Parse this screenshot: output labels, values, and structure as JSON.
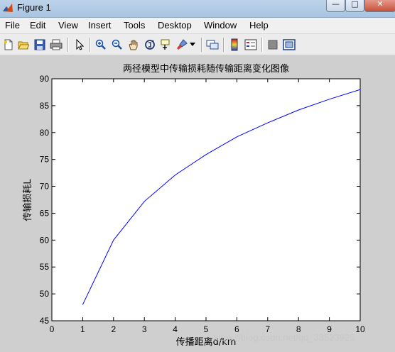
{
  "window": {
    "title": "Figure 1",
    "min_glyph": "—",
    "max_glyph": "□",
    "close_glyph": "✕"
  },
  "menu": [
    "File",
    "Edit",
    "View",
    "Insert",
    "Tools",
    "Desktop",
    "Window",
    "Help"
  ],
  "toolbar_icons": [
    "new-figure-icon",
    "open-file-icon",
    "save-icon",
    "print-icon",
    "edit-plot-arrow-icon",
    "zoom-in-icon",
    "zoom-out-icon",
    "pan-hand-icon",
    "rotate-3d-icon",
    "data-cursor-icon",
    "brush-icon",
    "brush-dropdown-icon",
    "link-plot-icon",
    "colorbar-icon",
    "legend-icon",
    "hide-plot-tools-icon",
    "show-plot-tools-icon"
  ],
  "chart_data": {
    "type": "line",
    "title": "两径模型中传输损耗随传输距离变化图像",
    "xlabel": "传播距离d/km",
    "ylabel": "传输损耗L",
    "xlim": [
      0,
      10
    ],
    "ylim": [
      45,
      90
    ],
    "xticks": [
      0,
      1,
      2,
      3,
      4,
      5,
      6,
      7,
      8,
      9,
      10
    ],
    "yticks": [
      45,
      50,
      55,
      60,
      65,
      70,
      75,
      80,
      85,
      90
    ],
    "grid": false,
    "line_color": "#0000ff",
    "series": [
      {
        "x": [
          1,
          2,
          3,
          4,
          5,
          6,
          7,
          8,
          9,
          10
        ],
        "y": [
          48.0,
          60.0,
          67.2,
          72.1,
          75.9,
          79.2,
          81.8,
          84.2,
          86.2,
          88.0
        ]
      }
    ]
  },
  "watermark": "https://blog.csdn.net/qq_33523925"
}
